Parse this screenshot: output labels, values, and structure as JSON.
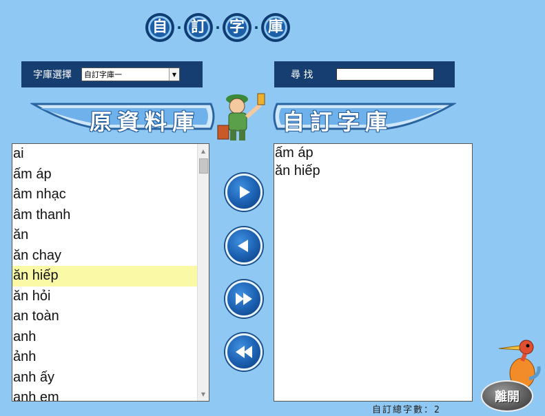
{
  "title": {
    "chars": [
      "自",
      "訂",
      "字",
      "庫"
    ],
    "separator": "·"
  },
  "toolbar": {
    "library_label": "字庫選擇",
    "library_selected": "自訂字庫一",
    "search_label": "尋 找",
    "search_value": ""
  },
  "banners": {
    "source": "原資料庫",
    "custom": "自訂字庫"
  },
  "source_list": {
    "items": [
      "ai",
      "ấm áp",
      "âm nhạc",
      "âm thanh",
      "ăn",
      "ăn chay",
      "ăn hiếp",
      "ăn hỏi",
      "an toàn",
      "anh",
      "ảnh",
      "anh ấy",
      "anh em"
    ],
    "selected_index": 6
  },
  "custom_list": {
    "items": [
      "ấm áp",
      "ăn hiếp"
    ]
  },
  "buttons": {
    "add": "add-icon",
    "remove": "remove-icon",
    "add_all": "add-all-icon",
    "remove_all": "remove-all-icon",
    "exit_label": "離開"
  },
  "footer": {
    "count_text": "自訂總字數：2"
  },
  "colors": {
    "background": "#8fc8f2",
    "toolbar": "#163e70",
    "selection": "#fafaa6",
    "button": "#1b5fb0"
  }
}
